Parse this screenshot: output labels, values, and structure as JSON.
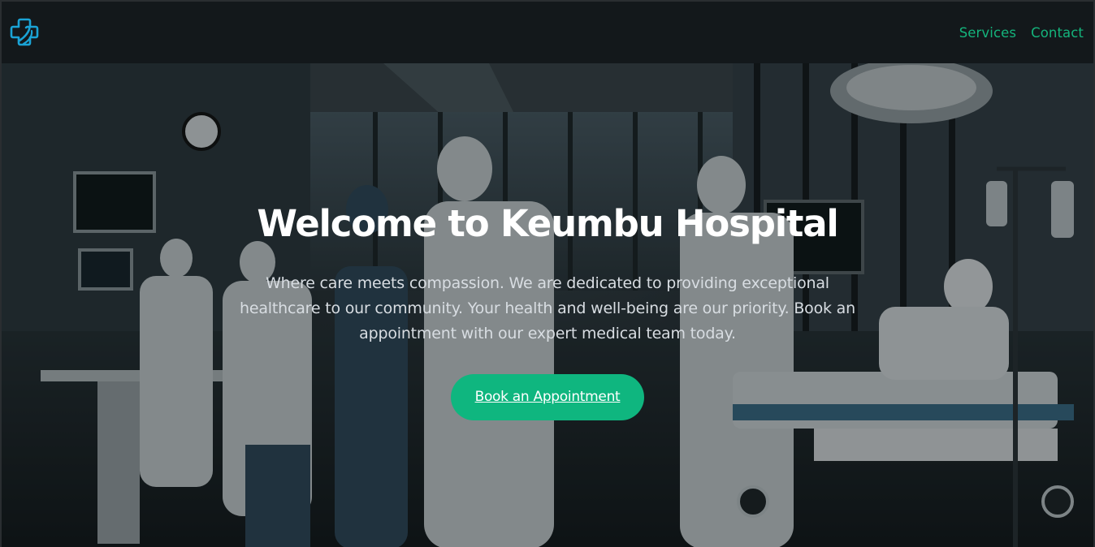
{
  "header": {
    "logo_icon": "medical-cross-logo-icon",
    "nav": [
      {
        "label": "Services"
      },
      {
        "label": "Contact"
      }
    ]
  },
  "hero": {
    "title": "Welcome to Keumbu Hospital",
    "subtitle": "Where care meets compassion. We are dedicated to providing exceptional healthcare to our community. Your health and well-being are our priority. Book an appointment with our expert medical team today.",
    "cta_label": "Book an Appointment"
  },
  "colors": {
    "accent": "#0fb67f",
    "nav_link": "#14b47c",
    "header_bg": "#13181b",
    "logo": "#1aa3d6"
  }
}
